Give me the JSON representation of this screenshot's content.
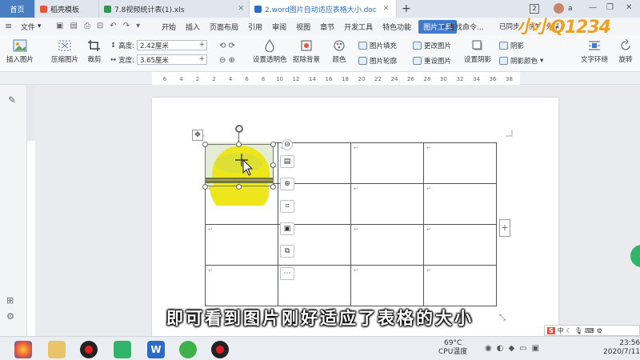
{
  "tabs": [
    {
      "label": "首页",
      "kind": "home"
    },
    {
      "label": "稻壳模板",
      "icon_color": "#e8533a"
    },
    {
      "label": "7.8视频统计表(1).xls",
      "icon_color": "#2f9a4d"
    },
    {
      "label": "2.word图片自动适应表格大小.doc",
      "icon_color": "#2a6cc5",
      "active": true
    }
  ],
  "tabbar": {
    "new_tab": "+",
    "badge": "2",
    "user": "a"
  },
  "menu": {
    "file": "文件",
    "items": [
      "开始",
      "插入",
      "页面布局",
      "引用",
      "审阅",
      "视图",
      "章节",
      "开发工具",
      "特色功能",
      "图片工具"
    ],
    "active_index": 9,
    "search": "查找命令...",
    "sync": "已同步",
    "collab": "协作",
    "share": "分享"
  },
  "ribbon": {
    "insert_picture": "插入图片",
    "compress": "压缩图片",
    "crop": "裁剪",
    "height_label": "高度:",
    "height_value": "2.42厘米",
    "width_label": "宽度:",
    "width_value": "3.65厘米",
    "transparent": "设置透明色",
    "remove_bg": "抠除背景",
    "color": "颜色",
    "fill": "图片填充",
    "outline": "图片轮廓",
    "change": "更改图片",
    "reset": "重设图片",
    "shadow": "设置阴影",
    "shadow_a": "阴影",
    "shadow_color": "阴影颜色",
    "wrap": "文字环绕",
    "rotate": "旋转"
  },
  "ruler": {
    "ticks": [
      "6",
      "4",
      "2",
      "2",
      "4",
      "6",
      "8",
      "10",
      "12",
      "14",
      "16",
      "18",
      "20",
      "22",
      "24",
      "26",
      "28",
      "30",
      "32",
      "34",
      "36",
      "38"
    ]
  },
  "table": {
    "rows": 4,
    "cols": 4,
    "cell_mark": "↵"
  },
  "float_toolbar": [
    "minus-icon",
    "layout-icon",
    "zoom-icon",
    "crop-icon",
    "picture-icon",
    "replace-icon",
    "more-icon"
  ],
  "watermark": "小小Q1234",
  "caption": "即可看到图片刚好适应了表格的大小",
  "taskbar": {
    "cpu_temp": "69°C",
    "cpu_label": "CPU温度",
    "time": "23:56",
    "date": "2020/7/11",
    "ime": "中"
  },
  "colors": {
    "accent": "#3d7ad0",
    "brand_watermark": "#f0a020"
  }
}
